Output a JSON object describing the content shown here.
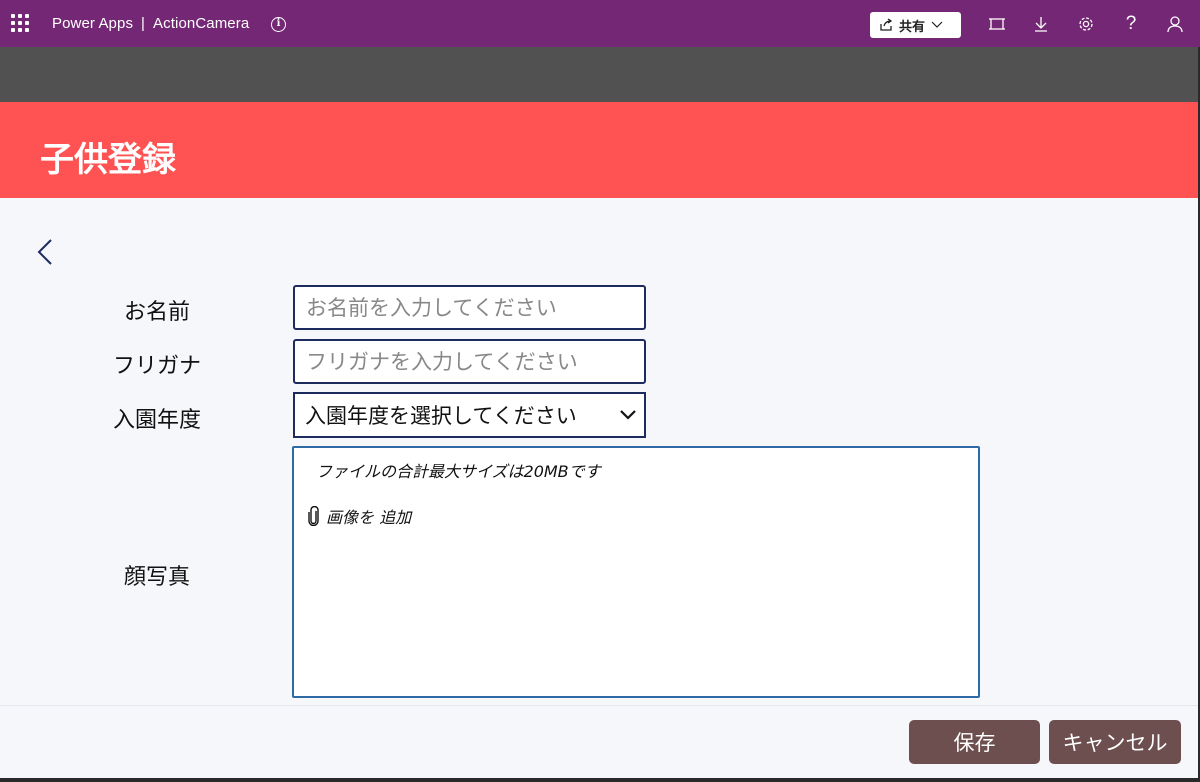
{
  "topbar": {
    "app_name": "Power Apps",
    "separator": "|",
    "project": "ActionCamera",
    "share_label": "共有",
    "colors": {
      "bar": "#742774"
    }
  },
  "page": {
    "title": "子供登録",
    "header_color": "#ff5252"
  },
  "form": {
    "name_label": "お名前",
    "name_placeholder": "お名前を入力してください",
    "kana_label": "フリガナ",
    "kana_placeholder": "フリガナを入力してください",
    "year_label": "入園年度",
    "year_selected": "入園年度を選択してください",
    "photo_label": "顔写真",
    "attach_note": "ファイルの合計最大サイズは20MBです",
    "attach_add_label": "画像を 追加"
  },
  "actions": {
    "save_label": "保存",
    "cancel_label": "キャンセル",
    "button_color": "#6d4f4f"
  },
  "icons": {
    "waffle": "app-launcher-icon",
    "info": "info-icon",
    "share": "share-icon",
    "fit": "fit-to-window-icon",
    "download": "download-icon",
    "settings": "gear-icon",
    "help": "help-icon",
    "user": "user-icon",
    "back": "chevron-left-icon",
    "dropdown": "chevron-down-icon",
    "attach": "paperclip-icon"
  }
}
